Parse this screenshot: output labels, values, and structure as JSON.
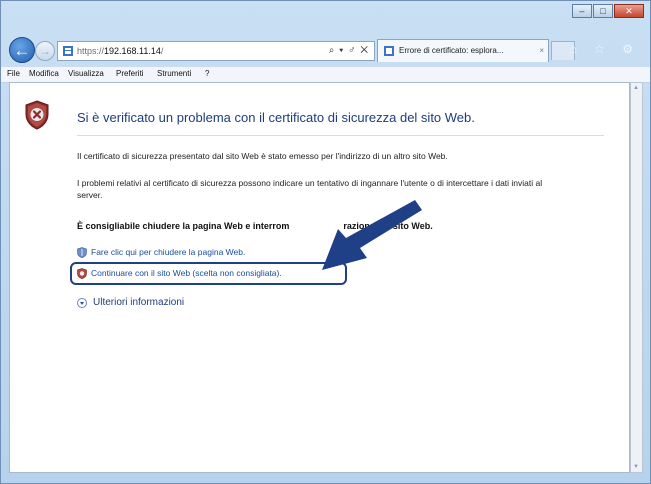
{
  "window": {
    "caption_buttons": {
      "minimize": "–",
      "maximize": "□",
      "close": "✕"
    }
  },
  "nav": {
    "back_icon": "arrow-left-icon",
    "forward_icon": "arrow-right-icon",
    "url_prefix": "https://",
    "url_host": "192.168.11.14",
    "url_suffix": "/",
    "address_controls": "⌕ ▾ ♂ ✕"
  },
  "tab": {
    "title": "Errore di certificato: esplora...",
    "close": "×"
  },
  "tools": "⌂ ☆ ⚙",
  "menu": [
    {
      "label": "File"
    },
    {
      "label": "Modifica"
    },
    {
      "label": "Visualizza"
    },
    {
      "label": "Preferiti"
    },
    {
      "label": "Strumenti"
    },
    {
      "label": "?"
    }
  ],
  "page": {
    "heading": "Si è verificato un problema con il certificato di sicurezza del sito Web.",
    "paragraph1": "Il certificato di sicurezza presentato dal sito Web è stato emesso per l'indirizzo di un altro sito Web.",
    "paragraph2": "I problemi relativi al certificato di sicurezza possono indicare un tentativo di ingannare l'utente o di intercettare i dati inviati al server.",
    "recommendation_before": "È consigliabile chiudere la pagina Web e interrom",
    "recommendation_after": "razione del sito Web.",
    "link_close": "Fare clic qui per chiudere la pagina Web.",
    "link_continue": "Continuare con il sito Web (scelta non consigliata).",
    "more_info": "Ulteriori informazioni"
  },
  "colors": {
    "heading": "#1f3d7a",
    "link": "#1a4c9b",
    "highlight_border": "#1f3f86",
    "arrow": "#1f3f86"
  }
}
